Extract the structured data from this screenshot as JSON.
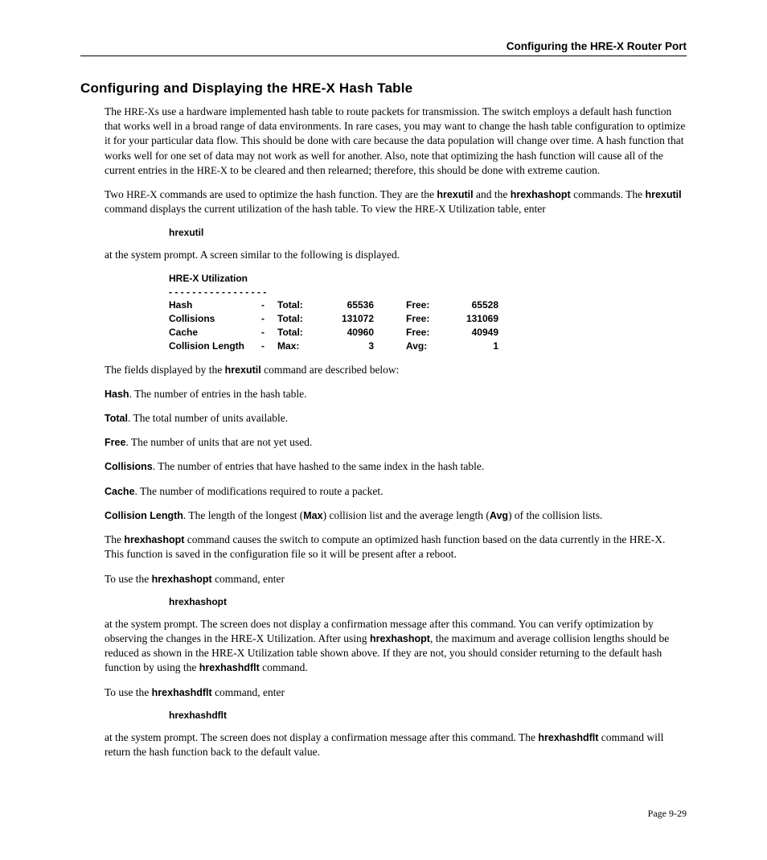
{
  "header": "Configuring the HRE-X Router Port",
  "section_title": "Configuring and Displaying the HRE-X Hash Table",
  "p1a": "The ",
  "p1b": "HRE-X",
  "p1c": "s use a hardware implemented hash table to route packets for transmission. The switch employs a default hash function that works well in a broad range of data environments. In rare cases, you may want to change the hash table configuration to optimize it for your particular data flow. This should be done with care because the data population will change over time. A hash function that works well for one set of data may not work as well for another. Also, note that optimizing the hash function will cause all of the current entries in the ",
  "p1d": "HRE-X",
  "p1e": " to be cleared and then relearned; therefore, this should be done with extreme caution.",
  "p2a": "Two ",
  "p2b": "HRE-X",
  "p2c": " commands are used to optimize the hash function. They are the ",
  "p2d": "hrexutil",
  "p2e": " and the ",
  "p2f": "hrexhashopt",
  "p2g": " commands. The ",
  "p2h": "hrexutil",
  "p2i": " command displays the current utilization of the hash table. To view the ",
  "p2j": "HRE-X",
  "p2k": " Utilization table, enter",
  "cmd1": "hrexutil",
  "p3": "at the system prompt. A screen similar to the following is displayed.",
  "table_title": "HRE-X Utilization",
  "table_sep": "- - - - - - - - - - - - - - - - -",
  "tr1": {
    "c1": "Hash",
    "c2": "-",
    "c3": "Total:",
    "c4": "65536",
    "c5": "Free:",
    "c6": "65528"
  },
  "tr2": {
    "c1": "Collisions",
    "c2": "-",
    "c3": "Total:",
    "c4": "131072",
    "c5": "Free:",
    "c6": "131069"
  },
  "tr3": {
    "c1": "Cache",
    "c2": "-",
    "c3": "Total:",
    "c4": "40960",
    "c5": "Free:",
    "c6": "40949"
  },
  "tr4": {
    "c1": "Collision Length",
    "c2": "-",
    "c3": "Max:",
    "c4": "3",
    "c5": "Avg:",
    "c6": "1"
  },
  "p4a": "The fields displayed by the ",
  "p4b": "hrexutil",
  "p4c": " command are described below:",
  "f1a": "Hash",
  "f1b": ". The number of entries in the hash table.",
  "f2a": "Total",
  "f2b": ". The total number of units available.",
  "f3a": "Free",
  "f3b": ". The number of units that are not yet used.",
  "f4a": "Collisions",
  "f4b": ". The number of entries that have hashed to the same index in the hash table.",
  "f5a": "Cache",
  "f5b": ". The number of modifications required to route a packet.",
  "f6a": "Collision Length",
  "f6b": ". The length of the longest (",
  "f6c": "Max",
  "f6d": ") collision list and the average length (",
  "f6e": "Avg",
  "f6f": ") of the collision lists.",
  "p5a": "The ",
  "p5b": "hrexhashopt",
  "p5c": " command causes the switch to compute an optimized hash function based on the data currently in the HRE-X. This function is saved in the configuration file so it will be present after a reboot.",
  "p6a": "To use the ",
  "p6b": "hrexhashopt",
  "p6c": " command, enter",
  "cmd2": "hrexhashopt",
  "p7a": "at the system prompt. The screen does not display a confirmation message after this command. You can verify optimization by observing the changes in the HRE-X Utilization. After using ",
  "p7b": "hrexhashopt",
  "p7c": ", the maximum and average collision lengths should be reduced as shown in the HRE-X Utilization table shown above. If they are not, you should consider returning to the default hash function by using the ",
  "p7d": "hrexhashdflt",
  "p7e": " command.",
  "p8a": "To use the ",
  "p8b": "hrexhashdflt",
  "p8c": " command, enter",
  "cmd3": "hrexhashdflt",
  "p9a": "at the system prompt. The screen does not display a confirmation message after this command. The ",
  "p9b": "hrexhashdflt",
  "p9c": " command will return the hash function back to the default value.",
  "footer": "Page 9-29"
}
